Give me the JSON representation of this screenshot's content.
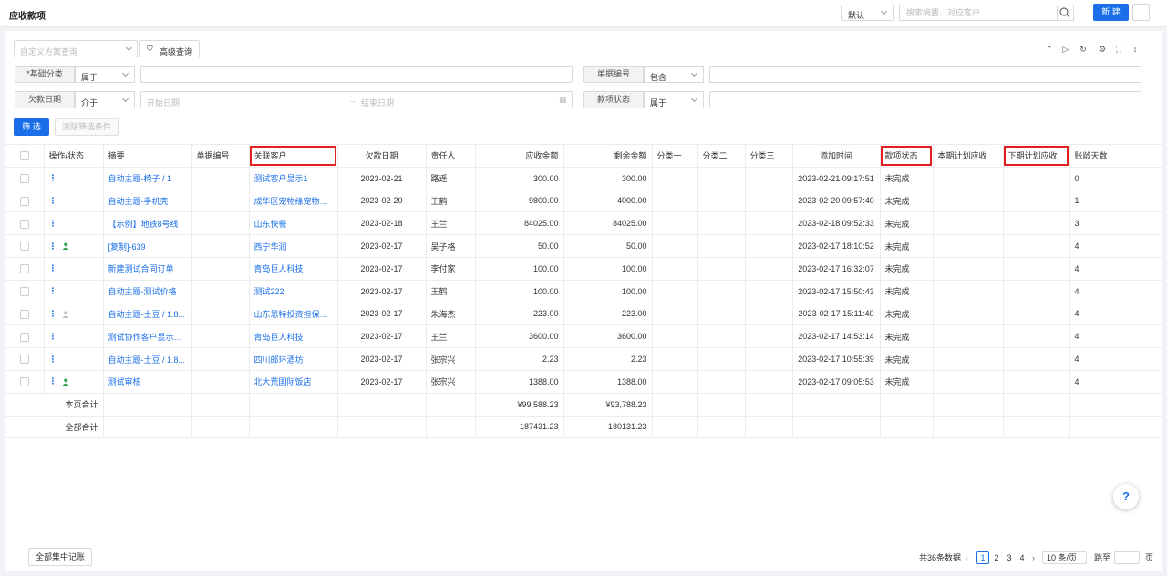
{
  "header": {
    "title": "应收款项",
    "view_select": "默认",
    "search_placeholder": "搜索摘要、对应客户",
    "new_label": "新 建",
    "more_label": "⋮"
  },
  "filters": {
    "custom_scheme_placeholder": "自定义方案查询",
    "advanced_query": "高级查询",
    "basic_category_label": "*基础分类",
    "basic_category_op": "属于",
    "doc_number_label": "单据编号",
    "doc_number_op": "包含",
    "due_date_label": "欠款日期",
    "due_date_op": "介于",
    "start_date_placeholder": "开始日期",
    "end_date_placeholder": "结束日期",
    "status_label": "款项状态",
    "status_op": "属于",
    "filter_button": "筛 选",
    "clear_button": "清除筛选条件"
  },
  "table": {
    "columns": [
      "操作/状态",
      "摘要",
      "单据编号",
      "关联客户",
      "欠款日期",
      "责任人",
      "应收金额",
      "剩余金额",
      "分类一",
      "分类二",
      "分类三",
      "添加时间",
      "款项状态",
      "本期计划应收",
      "下期计划应收",
      "账龄天数"
    ],
    "rows": [
      {
        "summary": "自动主题-椅子 / 1",
        "doc": "",
        "customer": "测试客户显示1",
        "date": "2023-02-21",
        "owner": "路遥",
        "receivable": "300.00",
        "remaining": "300.00",
        "added": "2023-02-21 09:17:51",
        "status": "未完成",
        "age": "0",
        "icon": ""
      },
      {
        "summary": "自动主题-手机壳",
        "doc": "",
        "customer": "成华区宠物缘宠物生...",
        "date": "2023-02-20",
        "owner": "王鹤",
        "receivable": "9800.00",
        "remaining": "4000.00",
        "added": "2023-02-20 09:57:40",
        "status": "未完成",
        "age": "1",
        "icon": ""
      },
      {
        "summary": "【示例】地铁8号线",
        "doc": "",
        "customer": "山东快餐",
        "date": "2023-02-18",
        "owner": "王兰",
        "receivable": "84025.00",
        "remaining": "84025.00",
        "added": "2023-02-18 09:52:33",
        "status": "未完成",
        "age": "3",
        "icon": ""
      },
      {
        "summary": "[复制]-639",
        "doc": "",
        "customer": "西宁华润",
        "date": "2023-02-17",
        "owner": "吴子格",
        "receivable": "50.00",
        "remaining": "50.00",
        "added": "2023-02-17 18:10:52",
        "status": "未完成",
        "age": "4",
        "icon": "green"
      },
      {
        "summary": "新建测试合同订单",
        "doc": "",
        "customer": "青岛巨人科技",
        "date": "2023-02-17",
        "owner": "李付家",
        "receivable": "100.00",
        "remaining": "100.00",
        "added": "2023-02-17 16:32:07",
        "status": "未完成",
        "age": "4",
        "icon": ""
      },
      {
        "summary": "自动主题-测试价格",
        "doc": "",
        "customer": "测试222",
        "date": "2023-02-17",
        "owner": "王鹤",
        "receivable": "100.00",
        "remaining": "100.00",
        "added": "2023-02-17 15:50:43",
        "status": "未完成",
        "age": "4",
        "icon": ""
      },
      {
        "summary": "自动主题-土豆 / 1.8...",
        "doc": "",
        "customer": "山东恩特投资担保有...",
        "date": "2023-02-17",
        "owner": "朱海杰",
        "receivable": "223.00",
        "remaining": "223.00",
        "added": "2023-02-17 15:11:40",
        "status": "未完成",
        "age": "4",
        "icon": "gray"
      },
      {
        "summary": "测试协作客户显示问题",
        "doc": "",
        "customer": "青岛巨人科技",
        "date": "2023-02-17",
        "owner": "王兰",
        "receivable": "3600.00",
        "remaining": "3600.00",
        "added": "2023-02-17 14:53:14",
        "status": "未完成",
        "age": "4",
        "icon": ""
      },
      {
        "summary": "自动主题-土豆 / 1.8...",
        "doc": "",
        "customer": "四川邮环酒坊",
        "date": "2023-02-17",
        "owner": "张宗兴",
        "receivable": "2.23",
        "remaining": "2.23",
        "added": "2023-02-17 10:55:39",
        "status": "未完成",
        "age": "4",
        "icon": ""
      },
      {
        "summary": "测试审核",
        "doc": "",
        "customer": "北大荒国际饭店",
        "date": "2023-02-17",
        "owner": "张宗兴",
        "receivable": "1388.00",
        "remaining": "1388.00",
        "added": "2023-02-17 09:05:53",
        "status": "未完成",
        "age": "4",
        "icon": "green"
      }
    ],
    "page_total": {
      "label": "本页合计",
      "receivable": "¥99,588.23",
      "remaining": "¥93,788.23"
    },
    "all_total": {
      "label": "全部合计",
      "receivable": "187431.23",
      "remaining": "180131.23"
    }
  },
  "footer": {
    "bulk_button": "全部集中记账",
    "total_records": "共36条数据",
    "pages": [
      "1",
      "2",
      "3",
      "4"
    ],
    "page_size": "10 条/页",
    "goto_label": "跳至",
    "page_unit": "页",
    "help": "?"
  },
  "colors": {
    "primary": "#1a6fe8",
    "highlight_box": "#e02020",
    "green_icon": "#2aa34a"
  }
}
